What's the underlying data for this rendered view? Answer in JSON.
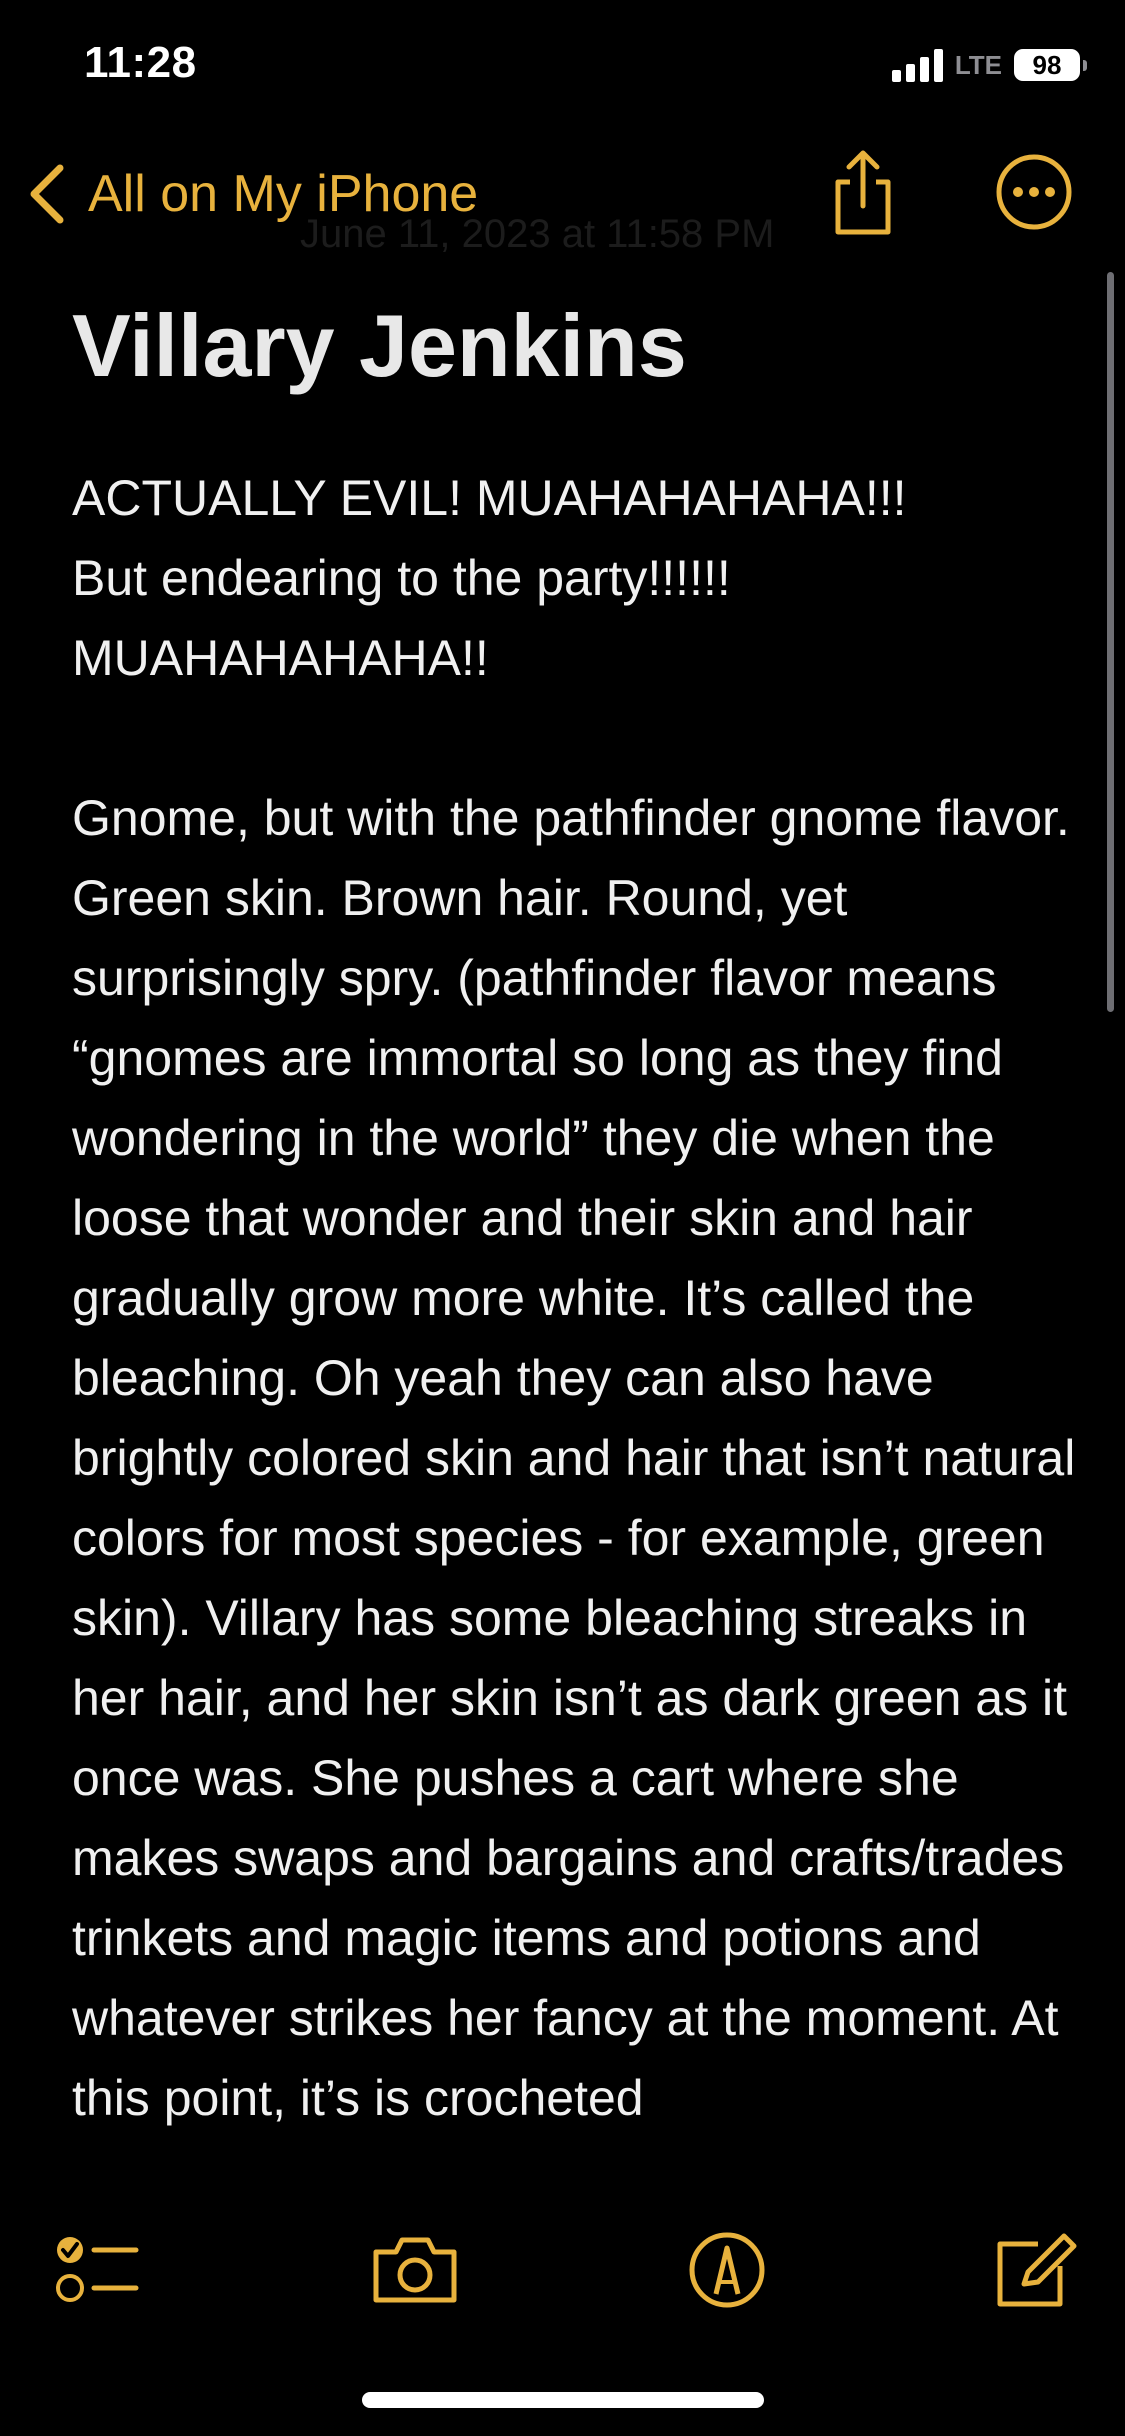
{
  "status_bar": {
    "time": "11:28",
    "network": "LTE",
    "battery": "98"
  },
  "nav": {
    "back_label": "All on My iPhone",
    "faded_date": "June 11, 2023 at 11:58 PM"
  },
  "note": {
    "title": "Villary Jenkins",
    "paragraph_1": "ACTUALLY EVIL! MUAHAHAHAHA!!!\nBut endearing to the party!!!!!!\nMUAHAHAHAHA!!",
    "paragraph_2": "Gnome, but with the pathfinder gnome flavor. Green skin. Brown hair. Round, yet surprisingly spry. (pathfinder flavor means “gnomes are immortal so long as they find wondering in the world” they die when the loose that wonder and their skin and hair gradually grow more white. It’s called the bleaching. Oh yeah they can also have brightly colored skin and hair that isn’t natural colors for most species - for example, green skin). Villary has some bleaching streaks in her hair, and her skin isn’t as dark green as it once was. She pushes a cart where she makes swaps and bargains and crafts/trades trinkets and magic items and potions and whatever strikes her fancy at the moment. At this point, it’s is crocheted"
  },
  "colors": {
    "accent": "#e8b23d",
    "background": "#000000",
    "text": "#f0f0f0"
  },
  "icons": {
    "back": "chevron-left-icon",
    "share": "share-icon",
    "more": "ellipsis-circle-icon",
    "checklist": "checklist-icon",
    "camera": "camera-icon",
    "markup": "markup-pen-icon",
    "compose": "compose-icon"
  }
}
